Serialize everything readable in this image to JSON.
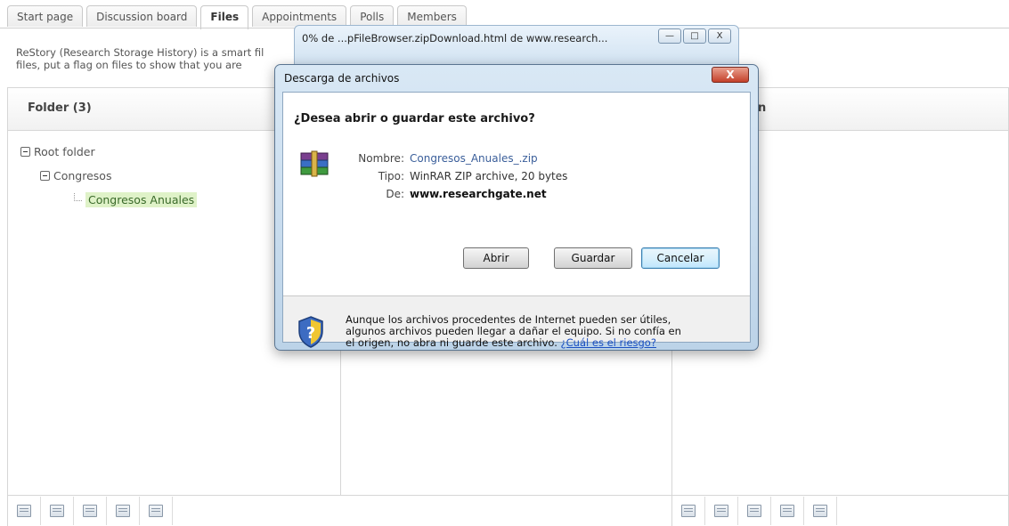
{
  "tabs": [
    {
      "label": "Start page",
      "active": false
    },
    {
      "label": "Discussion board",
      "active": false
    },
    {
      "label": "Files",
      "active": true
    },
    {
      "label": "Appointments",
      "active": false
    },
    {
      "label": "Polls",
      "active": false
    },
    {
      "label": "Members",
      "active": false
    }
  ],
  "description": {
    "line1": "ReStory (Research Storage History) is a smart fil",
    "line2": "files, put a flag on files to show that you are"
  },
  "panel": {
    "folder_header": "Folder (3)",
    "col3_header_fragment": "n",
    "tree": {
      "root": "Root folder",
      "child": "Congresos",
      "leaf": "Congresos Anuales"
    }
  },
  "toolbar_icons": {
    "left": [
      "new-folder-icon",
      "rename-folder-icon",
      "delete-folder-icon",
      "download-folder-icon",
      "upload-icon"
    ],
    "right": [
      "upload-file-icon",
      "download-file-icon",
      "lock-file-icon",
      "delete-file-icon",
      "history-icon"
    ]
  },
  "browser_window": {
    "title": "0% de ...pFileBrowser.zipDownload.html de www.research...",
    "minimize": "—",
    "maximize": "□",
    "close": "X"
  },
  "dialog": {
    "title": "Descarga de archivos",
    "close": "X",
    "question": "¿Desea abrir o guardar este archivo?",
    "name_label": "Nombre:",
    "name_value": "Congresos_Anuales_.zip",
    "type_label": "Tipo:",
    "type_value": "WinRAR ZIP archive, 20 bytes",
    "from_label": "De:",
    "from_value": "www.researchgate.net",
    "btn_open": "Abrir",
    "btn_save": "Guardar",
    "btn_cancel": "Cancelar",
    "warning_line1": "Aunque los archivos procedentes de Internet pueden ser útiles,",
    "warning_line2": "algunos archivos pueden llegar a dañar el equipo. Si no confía en",
    "warning_line3_prefix": "el origen, no abra ni guarde este archivo.",
    "warning_link": "¿Cuál es el riesgo?"
  }
}
